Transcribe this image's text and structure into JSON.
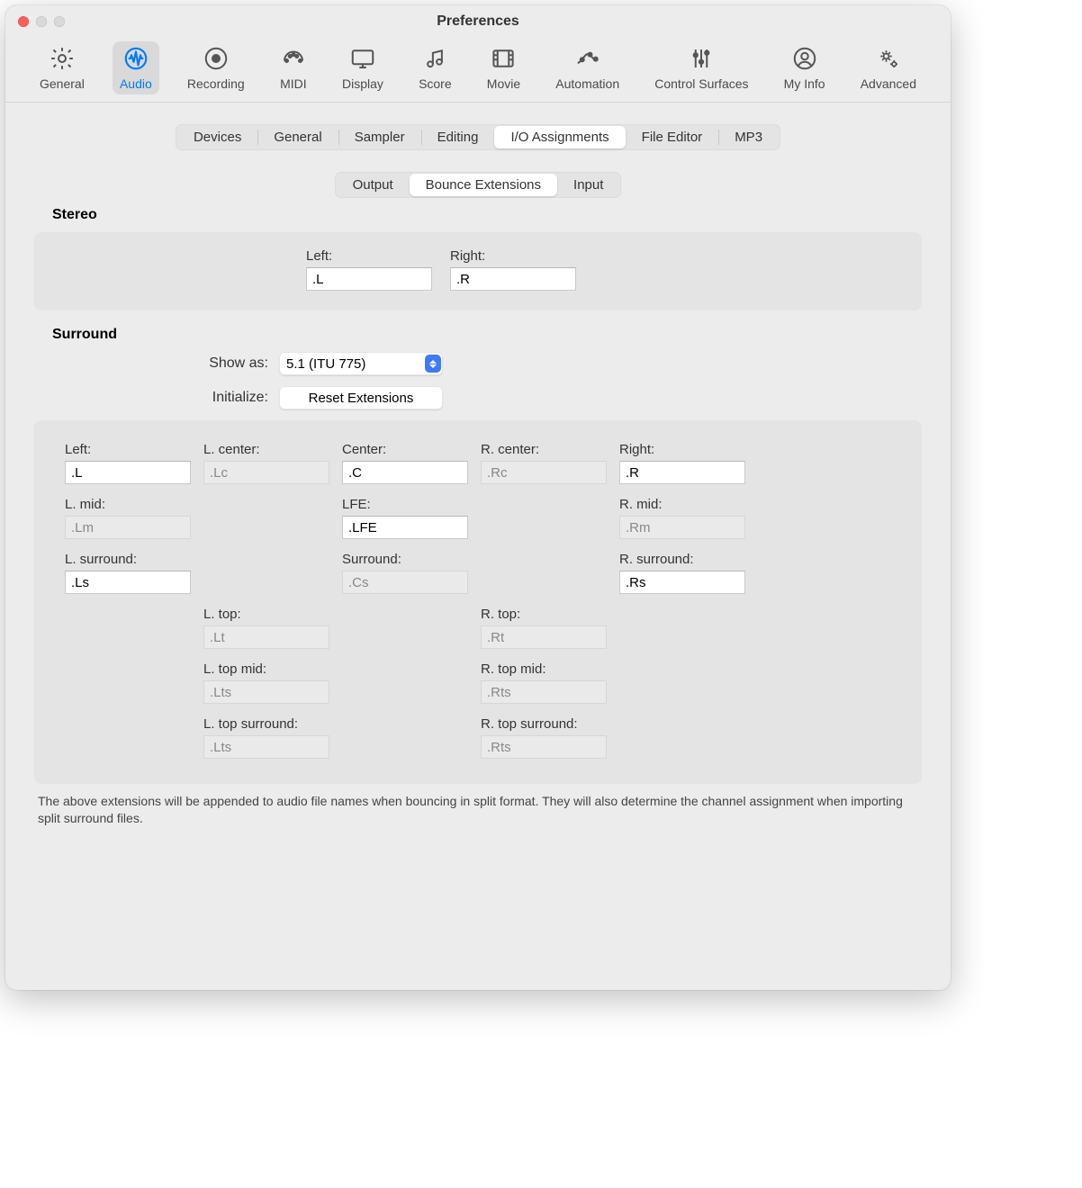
{
  "window": {
    "title": "Preferences"
  },
  "toolbar": [
    {
      "id": "general",
      "label": "General"
    },
    {
      "id": "audio",
      "label": "Audio",
      "active": true
    },
    {
      "id": "recording",
      "label": "Recording"
    },
    {
      "id": "midi",
      "label": "MIDI"
    },
    {
      "id": "display",
      "label": "Display"
    },
    {
      "id": "score",
      "label": "Score"
    },
    {
      "id": "movie",
      "label": "Movie"
    },
    {
      "id": "automation",
      "label": "Automation"
    },
    {
      "id": "surfaces",
      "label": "Control Surfaces"
    },
    {
      "id": "myinfo",
      "label": "My Info"
    },
    {
      "id": "advanced",
      "label": "Advanced"
    }
  ],
  "tabs1": {
    "items": [
      "Devices",
      "General",
      "Sampler",
      "Editing",
      "I/O Assignments",
      "File Editor",
      "MP3"
    ],
    "active": "I/O Assignments"
  },
  "tabs2": {
    "items": [
      "Output",
      "Bounce Extensions",
      "Input"
    ],
    "active": "Bounce Extensions"
  },
  "sections": {
    "stereo_label": "Stereo",
    "surround_label": "Surround"
  },
  "stereo": {
    "left": {
      "label": "Left:",
      "value": ".L"
    },
    "right": {
      "label": "Right:",
      "value": ".R"
    }
  },
  "surround_controls": {
    "show_as_label": "Show as:",
    "show_as_value": "5.1 (ITU 775)",
    "initialize_label": "Initialize:",
    "reset_button": "Reset Extensions"
  },
  "surround_grid": [
    [
      {
        "label": "Left:",
        "value": ".L",
        "enabled": true
      },
      {
        "label": "L. center:",
        "value": ".Lc",
        "enabled": false
      },
      {
        "label": "Center:",
        "value": ".C",
        "enabled": true
      },
      {
        "label": "R. center:",
        "value": ".Rc",
        "enabled": false
      },
      {
        "label": "Right:",
        "value": ".R",
        "enabled": true
      }
    ],
    [
      {
        "label": "L. mid:",
        "value": ".Lm",
        "enabled": false
      },
      null,
      {
        "label": "LFE:",
        "value": ".LFE",
        "enabled": true
      },
      null,
      {
        "label": "R. mid:",
        "value": ".Rm",
        "enabled": false
      }
    ],
    [
      {
        "label": "L. surround:",
        "value": ".Ls",
        "enabled": true
      },
      null,
      {
        "label": "Surround:",
        "value": ".Cs",
        "enabled": false
      },
      null,
      {
        "label": "R. surround:",
        "value": ".Rs",
        "enabled": true
      }
    ],
    [
      null,
      {
        "label": "L. top:",
        "value": ".Lt",
        "enabled": false
      },
      null,
      {
        "label": "R. top:",
        "value": ".Rt",
        "enabled": false
      },
      null
    ],
    [
      null,
      {
        "label": "L. top mid:",
        "value": ".Lts",
        "enabled": false
      },
      null,
      {
        "label": "R. top mid:",
        "value": ".Rts",
        "enabled": false
      },
      null
    ],
    [
      null,
      {
        "label": "L. top surround:",
        "value": ".Lts",
        "enabled": false
      },
      null,
      {
        "label": "R. top surround:",
        "value": ".Rts",
        "enabled": false
      },
      null
    ]
  ],
  "footer": "The above extensions will be appended to audio file names when bouncing in split format. They will also determine the channel assignment when importing split surround files."
}
